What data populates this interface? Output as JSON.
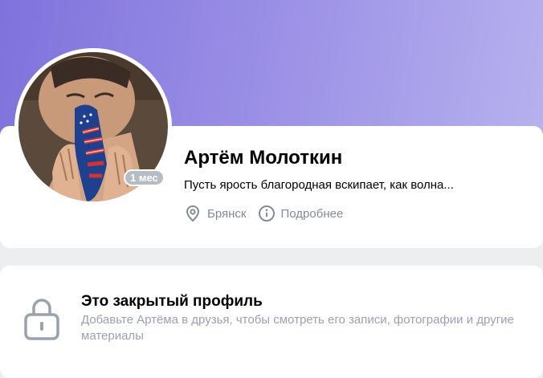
{
  "profile": {
    "name": "Артём Молоткин",
    "status": "Пусть ярость благородная вскипает, как волна...",
    "last_seen_badge": "1 мес",
    "city": "Брянск",
    "details_label": "Подробнее"
  },
  "private_profile": {
    "title": "Это закрытый профиль",
    "description": "Добавьте Артёма в друзья, чтобы смотреть его записи, фотографии и другие материалы"
  },
  "icons": {
    "location": "location-pin-icon",
    "info": "info-circle-icon",
    "lock": "lock-icon"
  },
  "colors": {
    "cover_gradient_start": "#7f72dc",
    "cover_gradient_end": "#b7b1ee",
    "secondary_text": "#818c99",
    "badge": "#b6bcc4"
  }
}
